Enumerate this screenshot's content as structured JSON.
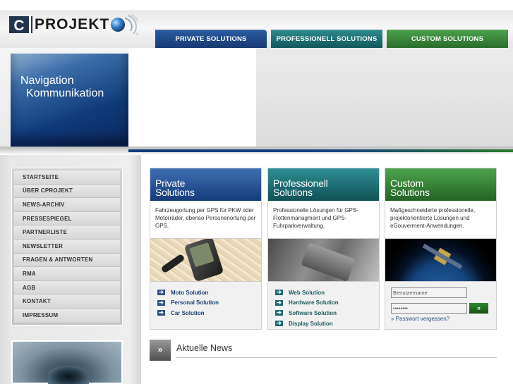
{
  "logo": {
    "letter": "C",
    "word": "PROJEKT"
  },
  "topnav": {
    "items": [
      {
        "label": "PRIVATE SOLUTIONS"
      },
      {
        "label": "PROFESSIONELL SOLUTIONS"
      },
      {
        "label": "CUSTOM SOLUTIONS"
      }
    ]
  },
  "banner": {
    "line1": "Navigation",
    "line2": "Kommunikation"
  },
  "sidebar": {
    "items": [
      {
        "label": "STARTSEITE"
      },
      {
        "label": "ÜBER CPROJEKT"
      },
      {
        "label": "NEWS-ARCHIV"
      },
      {
        "label": "PRESSESPIEGEL"
      },
      {
        "label": "PARTNERLISTE"
      },
      {
        "label": "NEWSLETTER"
      },
      {
        "label": "FRAGEN & ANTWORTEN"
      },
      {
        "label": "RMA"
      },
      {
        "label": "AGB"
      },
      {
        "label": "KONTAKT"
      },
      {
        "label": "IMPRESSUM"
      }
    ]
  },
  "columns": {
    "private": {
      "title1": "Private",
      "title2": "Solutions",
      "text": "Fahrzeugortung per GPS für PKW oder Motorräder, ebenso Personenortung per GPS.",
      "links": [
        "Moto Solution",
        "Personal Solution",
        "Car Solution"
      ]
    },
    "prof": {
      "title1": "Professionell",
      "title2": "Solutions",
      "text": "Professionelle Lösungen für GPS-Flottenmanagment und GPS-Fuhrparkverwaltung.",
      "links": [
        "Web Solution",
        "Hardware Solution",
        "Software Solution",
        "Display Solution"
      ]
    },
    "custom": {
      "title1": "Custom",
      "title2": "Solutions",
      "text": "Maßgeschneiderte professionelle, projektorientierte Lösungen und eGouverment-Anwendungen.",
      "login": {
        "username_value": "Benutzername",
        "password_value": "••••••••",
        "submit_label": "»",
        "forgot_label": "» Passwort vergessen?"
      }
    }
  },
  "news": {
    "icon_label": "»",
    "title": "Aktuelle News"
  },
  "colors": {
    "private": "#153d7a",
    "prof": "#115156",
    "custom": "#246324"
  }
}
